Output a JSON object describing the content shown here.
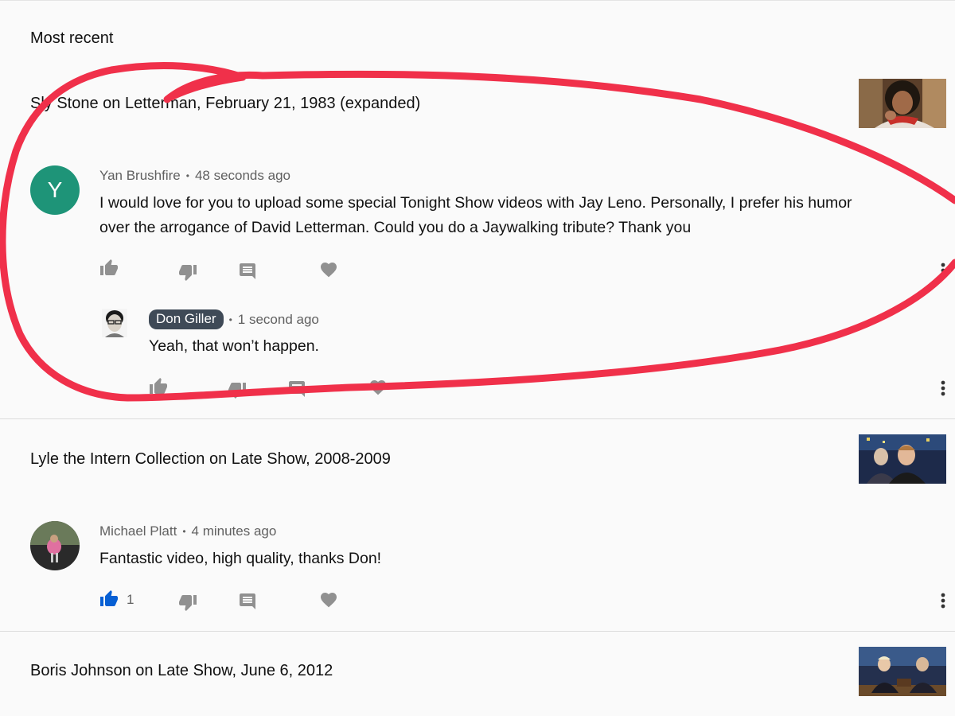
{
  "section": {
    "heading": "Most recent"
  },
  "videos": [
    {
      "title": "Sly Stone on Letterman, February 21, 1983 (expanded)",
      "comment": {
        "avatar_letter": "Y",
        "author": "Yan Brushfire",
        "time": "48 seconds ago",
        "text_line1": "I would love for you to upload some special Tonight Show videos with Jay Leno. Personally,  I prefer his humor",
        "text_line2": "over the arrogance of David Letterman. Could you do a Jaywalking tribute? Thank you"
      },
      "reply": {
        "author": "Don Giller",
        "time": "1 second ago",
        "text": "Yeah, that won’t happen."
      }
    },
    {
      "title": "Lyle the Intern Collection on Late Show, 2008-2009",
      "comment": {
        "author": "Michael Platt",
        "time": "4 minutes ago",
        "text": "Fantastic video, high quality, thanks Don!",
        "like_count": "1"
      }
    },
    {
      "title": "Boris Johnson on Late Show, June 6, 2012"
    }
  ],
  "icons": {
    "like": "thumb-up-icon",
    "dislike": "thumb-down-icon",
    "reply": "reply-icon",
    "heart": "heart-icon",
    "more": "more-vert-icon"
  },
  "colors": {
    "accent_like": "#065fd4",
    "icon_gray": "#909090",
    "avatar_green": "#1e9478",
    "annotation_red": "#f0304a",
    "author_chip": "#3f4a57"
  }
}
